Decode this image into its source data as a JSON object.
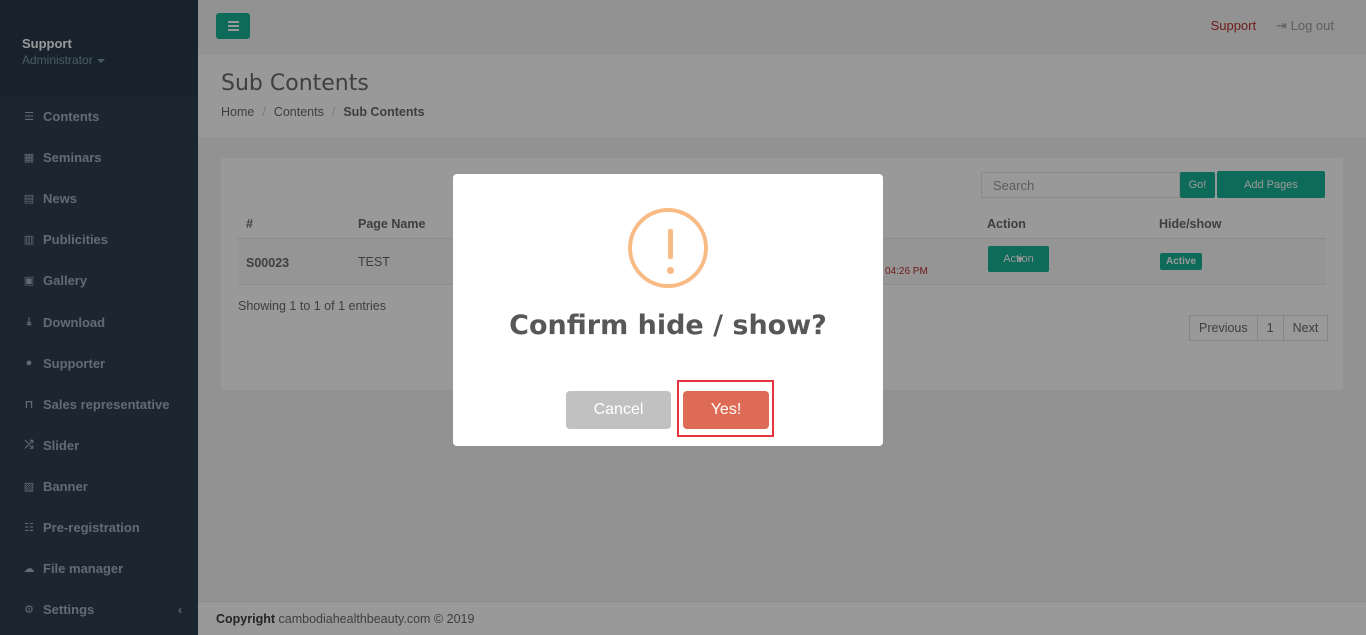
{
  "profile": {
    "name": "Support",
    "role": "Administrator"
  },
  "sidebar": {
    "items": [
      {
        "label": "Contents",
        "icon": "list-icon"
      },
      {
        "label": "Seminars",
        "icon": "calendar-icon"
      },
      {
        "label": "News",
        "icon": "newspaper-icon"
      },
      {
        "label": "Publicities",
        "icon": "book-icon"
      },
      {
        "label": "Gallery",
        "icon": "image-icon"
      },
      {
        "label": "Download",
        "icon": "download-icon"
      },
      {
        "label": "Supporter",
        "icon": "users-icon"
      },
      {
        "label": "Sales representative",
        "icon": "bookmark-icon"
      },
      {
        "label": "Slider",
        "icon": "shuffle-icon"
      },
      {
        "label": "Banner",
        "icon": "picture-icon"
      },
      {
        "label": "Pre-registration",
        "icon": "list-alt-icon"
      },
      {
        "label": "File manager",
        "icon": "cloud-icon"
      },
      {
        "label": "Settings",
        "icon": "cogs-icon"
      }
    ]
  },
  "topbar": {
    "support": "Support",
    "logout": "Log out"
  },
  "page": {
    "title": "Sub Contents",
    "breadcrumb": [
      "Home",
      "Contents",
      "Sub Contents"
    ]
  },
  "toolbar": {
    "search_placeholder": "Search",
    "go_label": "Go!",
    "add_label": "Add Pages"
  },
  "table": {
    "headers": {
      "id": "#",
      "page_name": "Page Name",
      "action": "Action",
      "hide_show": "Hide/show"
    },
    "row": {
      "id": "S00023",
      "page_name": "TEST",
      "date_fragment": "04:26 PM",
      "action_label": "Action",
      "status": "Active"
    }
  },
  "info": "Showing 1 to 1 of 1 entries",
  "pager": {
    "prev": "Previous",
    "page": "1",
    "next": "Next"
  },
  "footer": {
    "bold": "Copyright",
    "text": "cambodiahealthbeauty.com © 2019"
  },
  "modal": {
    "title": "Confirm hide / show?",
    "cancel": "Cancel",
    "confirm": "Yes!"
  },
  "colors": {
    "sidebar": "#2f4050",
    "accent": "#1ab394",
    "confirm": "#dd6b55",
    "warning": "#f8bb86"
  }
}
